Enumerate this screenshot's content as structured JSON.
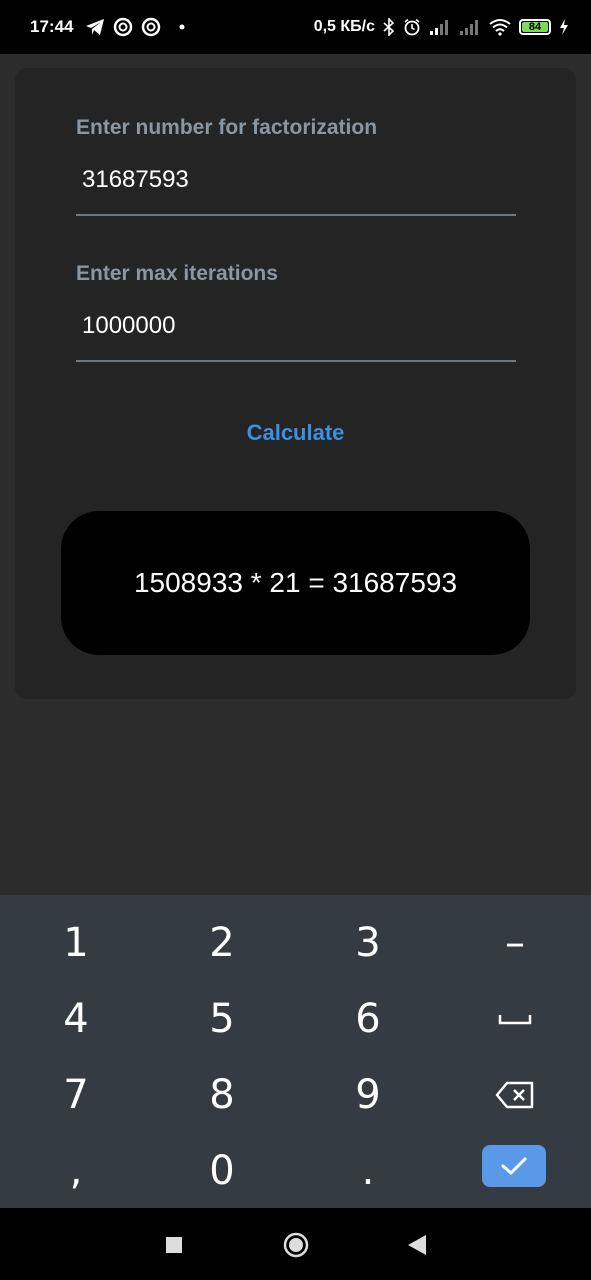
{
  "status_bar": {
    "time": "17:44",
    "network_speed": "0,5 КБ/с",
    "battery": "84",
    "icons_left": [
      "telegram-icon",
      "app-notification-icon",
      "app-notification-icon",
      "dot-icon"
    ],
    "icons_right": [
      "bluetooth-icon",
      "alarm-icon",
      "signal-icon",
      "signal-icon",
      "wifi-icon",
      "battery-icon",
      "charging-icon"
    ]
  },
  "form": {
    "number_label": "Enter number for factorization",
    "number_value": "31687593",
    "iterations_label": "Enter max iterations",
    "iterations_value": "1000000",
    "calculate_label": "Calculate",
    "result": "1508933 * 21 = 31687593"
  },
  "keyboard": {
    "rows": [
      [
        "1",
        "2",
        "3",
        "-"
      ],
      [
        "4",
        "5",
        "6",
        "space"
      ],
      [
        "7",
        "8",
        "9",
        "backspace"
      ],
      [
        ",",
        "0",
        ".",
        "enter"
      ]
    ],
    "keys": {
      "k1": "1",
      "k2": "2",
      "k3": "3",
      "minus": "–",
      "k4": "4",
      "k5": "5",
      "k6": "6",
      "k7": "7",
      "k8": "8",
      "k9": "9",
      "comma": ",",
      "k0": "0",
      "period": "."
    }
  },
  "colors": {
    "accent": "#3d8fe0",
    "enter_key": "#5a98e8",
    "card_bg": "#242424",
    "page_bg": "#2c2c2c",
    "keyboard_bg": "#353b42",
    "label": "#8c96a0"
  }
}
